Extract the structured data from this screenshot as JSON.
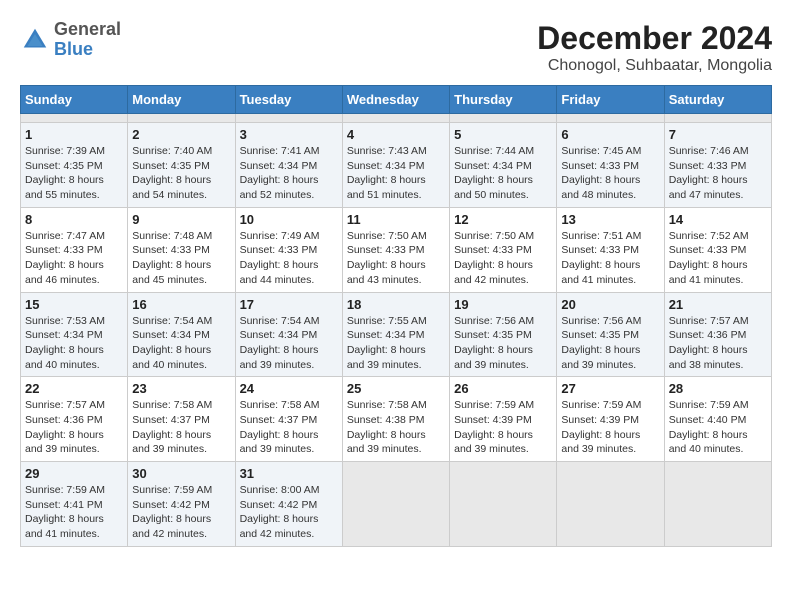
{
  "header": {
    "logo_line1": "General",
    "logo_line2": "Blue",
    "title": "December 2024",
    "subtitle": "Chonogol, Suhbaatar, Mongolia"
  },
  "calendar": {
    "days_of_week": [
      "Sunday",
      "Monday",
      "Tuesday",
      "Wednesday",
      "Thursday",
      "Friday",
      "Saturday"
    ],
    "weeks": [
      [
        {
          "day": null,
          "info": ""
        },
        {
          "day": null,
          "info": ""
        },
        {
          "day": null,
          "info": ""
        },
        {
          "day": null,
          "info": ""
        },
        {
          "day": null,
          "info": ""
        },
        {
          "day": null,
          "info": ""
        },
        {
          "day": null,
          "info": ""
        }
      ],
      [
        {
          "day": "1",
          "info": "Sunrise: 7:39 AM\nSunset: 4:35 PM\nDaylight: 8 hours\nand 55 minutes."
        },
        {
          "day": "2",
          "info": "Sunrise: 7:40 AM\nSunset: 4:35 PM\nDaylight: 8 hours\nand 54 minutes."
        },
        {
          "day": "3",
          "info": "Sunrise: 7:41 AM\nSunset: 4:34 PM\nDaylight: 8 hours\nand 52 minutes."
        },
        {
          "day": "4",
          "info": "Sunrise: 7:43 AM\nSunset: 4:34 PM\nDaylight: 8 hours\nand 51 minutes."
        },
        {
          "day": "5",
          "info": "Sunrise: 7:44 AM\nSunset: 4:34 PM\nDaylight: 8 hours\nand 50 minutes."
        },
        {
          "day": "6",
          "info": "Sunrise: 7:45 AM\nSunset: 4:33 PM\nDaylight: 8 hours\nand 48 minutes."
        },
        {
          "day": "7",
          "info": "Sunrise: 7:46 AM\nSunset: 4:33 PM\nDaylight: 8 hours\nand 47 minutes."
        }
      ],
      [
        {
          "day": "8",
          "info": "Sunrise: 7:47 AM\nSunset: 4:33 PM\nDaylight: 8 hours\nand 46 minutes."
        },
        {
          "day": "9",
          "info": "Sunrise: 7:48 AM\nSunset: 4:33 PM\nDaylight: 8 hours\nand 45 minutes."
        },
        {
          "day": "10",
          "info": "Sunrise: 7:49 AM\nSunset: 4:33 PM\nDaylight: 8 hours\nand 44 minutes."
        },
        {
          "day": "11",
          "info": "Sunrise: 7:50 AM\nSunset: 4:33 PM\nDaylight: 8 hours\nand 43 minutes."
        },
        {
          "day": "12",
          "info": "Sunrise: 7:50 AM\nSunset: 4:33 PM\nDaylight: 8 hours\nand 42 minutes."
        },
        {
          "day": "13",
          "info": "Sunrise: 7:51 AM\nSunset: 4:33 PM\nDaylight: 8 hours\nand 41 minutes."
        },
        {
          "day": "14",
          "info": "Sunrise: 7:52 AM\nSunset: 4:33 PM\nDaylight: 8 hours\nand 41 minutes."
        }
      ],
      [
        {
          "day": "15",
          "info": "Sunrise: 7:53 AM\nSunset: 4:34 PM\nDaylight: 8 hours\nand 40 minutes."
        },
        {
          "day": "16",
          "info": "Sunrise: 7:54 AM\nSunset: 4:34 PM\nDaylight: 8 hours\nand 40 minutes."
        },
        {
          "day": "17",
          "info": "Sunrise: 7:54 AM\nSunset: 4:34 PM\nDaylight: 8 hours\nand 39 minutes."
        },
        {
          "day": "18",
          "info": "Sunrise: 7:55 AM\nSunset: 4:34 PM\nDaylight: 8 hours\nand 39 minutes."
        },
        {
          "day": "19",
          "info": "Sunrise: 7:56 AM\nSunset: 4:35 PM\nDaylight: 8 hours\nand 39 minutes."
        },
        {
          "day": "20",
          "info": "Sunrise: 7:56 AM\nSunset: 4:35 PM\nDaylight: 8 hours\nand 39 minutes."
        },
        {
          "day": "21",
          "info": "Sunrise: 7:57 AM\nSunset: 4:36 PM\nDaylight: 8 hours\nand 38 minutes."
        }
      ],
      [
        {
          "day": "22",
          "info": "Sunrise: 7:57 AM\nSunset: 4:36 PM\nDaylight: 8 hours\nand 39 minutes."
        },
        {
          "day": "23",
          "info": "Sunrise: 7:58 AM\nSunset: 4:37 PM\nDaylight: 8 hours\nand 39 minutes."
        },
        {
          "day": "24",
          "info": "Sunrise: 7:58 AM\nSunset: 4:37 PM\nDaylight: 8 hours\nand 39 minutes."
        },
        {
          "day": "25",
          "info": "Sunrise: 7:58 AM\nSunset: 4:38 PM\nDaylight: 8 hours\nand 39 minutes."
        },
        {
          "day": "26",
          "info": "Sunrise: 7:59 AM\nSunset: 4:39 PM\nDaylight: 8 hours\nand 39 minutes."
        },
        {
          "day": "27",
          "info": "Sunrise: 7:59 AM\nSunset: 4:39 PM\nDaylight: 8 hours\nand 39 minutes."
        },
        {
          "day": "28",
          "info": "Sunrise: 7:59 AM\nSunset: 4:40 PM\nDaylight: 8 hours\nand 40 minutes."
        }
      ],
      [
        {
          "day": "29",
          "info": "Sunrise: 7:59 AM\nSunset: 4:41 PM\nDaylight: 8 hours\nand 41 minutes."
        },
        {
          "day": "30",
          "info": "Sunrise: 7:59 AM\nSunset: 4:42 PM\nDaylight: 8 hours\nand 42 minutes."
        },
        {
          "day": "31",
          "info": "Sunrise: 8:00 AM\nSunset: 4:42 PM\nDaylight: 8 hours\nand 42 minutes."
        },
        {
          "day": null,
          "info": ""
        },
        {
          "day": null,
          "info": ""
        },
        {
          "day": null,
          "info": ""
        },
        {
          "day": null,
          "info": ""
        }
      ]
    ]
  }
}
